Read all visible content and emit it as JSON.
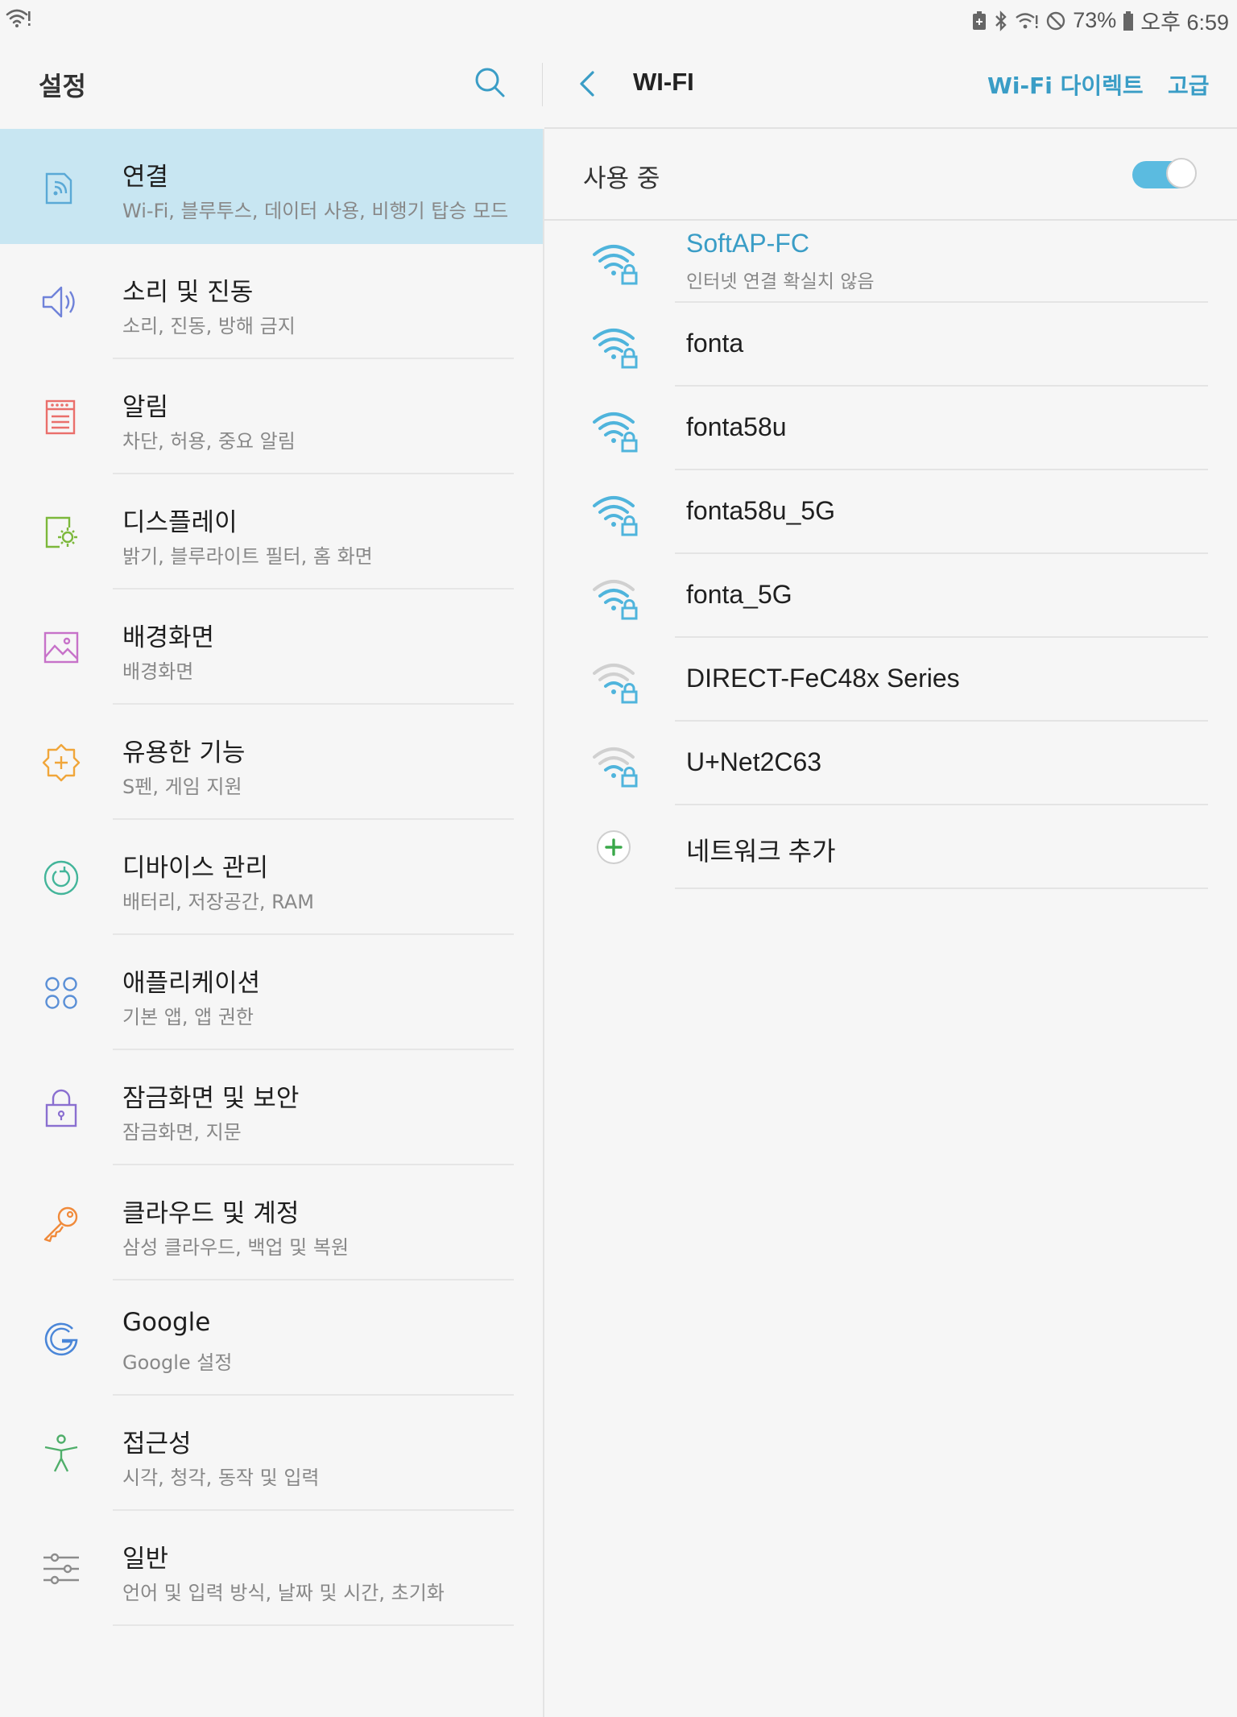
{
  "status_bar": {
    "battery": "73%",
    "time": "오후 6:59"
  },
  "left": {
    "title": "설정",
    "menu": [
      {
        "title": "연결",
        "subtitle": "Wi-Fi, 블루투스, 데이터 사용, 비행기 탑승 모드",
        "icon": "connections-icon",
        "color": "#5aa9d6"
      },
      {
        "title": "소리 및 진동",
        "subtitle": "소리, 진동, 방해 금지",
        "icon": "speaker-icon",
        "color": "#6f82d9"
      },
      {
        "title": "알림",
        "subtitle": "차단, 허용, 중요 알림",
        "icon": "notification-icon",
        "color": "#ea6f6b"
      },
      {
        "title": "디스플레이",
        "subtitle": "밝기, 블루라이트 필터, 홈 화면",
        "icon": "display-icon",
        "color": "#7cb83b"
      },
      {
        "title": "배경화면",
        "subtitle": "배경화면",
        "icon": "wallpaper-icon",
        "color": "#c772c9"
      },
      {
        "title": "유용한 기능",
        "subtitle": "S펜, 게임 지원",
        "icon": "advanced-features-icon",
        "color": "#f0a63a"
      },
      {
        "title": "디바이스 관리",
        "subtitle": "배터리, 저장공간, RAM",
        "icon": "device-care-icon",
        "color": "#43b59a"
      },
      {
        "title": "애플리케이션",
        "subtitle": "기본 앱, 앱 권한",
        "icon": "apps-icon",
        "color": "#5a8fd6"
      },
      {
        "title": "잠금화면 및 보안",
        "subtitle": "잠금화면, 지문",
        "icon": "lock-icon",
        "color": "#8a6fd0"
      },
      {
        "title": "클라우드 및 계정",
        "subtitle": "삼성 클라우드, 백업 및 복원",
        "icon": "key-icon",
        "color": "#f08a3a"
      },
      {
        "title": "Google",
        "subtitle": "Google 설정",
        "icon": "google-icon",
        "color": "#4a86d8"
      },
      {
        "title": "접근성",
        "subtitle": "시각, 청각, 동작 및 입력",
        "icon": "accessibility-icon",
        "color": "#4fae6a"
      },
      {
        "title": "일반",
        "subtitle": "언어 및 입력 방식, 날짜 및 시간, 초기화",
        "icon": "sliders-icon",
        "color": "#8c8c8c"
      }
    ]
  },
  "right": {
    "title": "WI-FI",
    "wifi_direct": "Wi-Fi 다이렉트",
    "advanced": "고급",
    "toggle_label": "사용 중",
    "toggle_on": true,
    "networks": [
      {
        "name": "SoftAP-FC",
        "status": "인터넷 연결 확실치 않음",
        "strength": "strong",
        "secured": true,
        "connected": true
      },
      {
        "name": "fonta",
        "strength": "strong",
        "secured": true
      },
      {
        "name": "fonta58u",
        "strength": "strong",
        "secured": true
      },
      {
        "name": "fonta58u_5G",
        "strength": "strong",
        "secured": true
      },
      {
        "name": "fonta_5G",
        "strength": "weak",
        "secured": true
      },
      {
        "name": "DIRECT-FeC48x Series",
        "strength": "weak",
        "secured": true
      },
      {
        "name": "U+Net2C63",
        "strength": "weak",
        "secured": true
      }
    ],
    "add_network": "네트워크 추가",
    "accent_color": "#3a9dc6",
    "add_color": "#3aa84a"
  }
}
